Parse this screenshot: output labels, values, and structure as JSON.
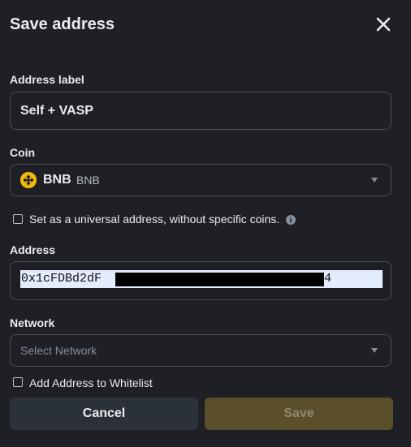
{
  "modal": {
    "title": "Save address",
    "close_icon": "close-icon"
  },
  "address_label": {
    "label": "Address label",
    "value": "Self + VASP"
  },
  "coin": {
    "label": "Coin",
    "symbol": "BNB",
    "name": "BNB",
    "icon": "bnb-coin-icon",
    "icon_color": "#f0b90b"
  },
  "universal": {
    "label": "Set as a universal address, without specific coins.",
    "checked": false,
    "info_icon": "info-icon"
  },
  "address": {
    "label": "Address",
    "value_visible": "0x1cFDBd2dF",
    "value_tail": "4"
  },
  "network": {
    "label": "Network",
    "placeholder": "Select Network"
  },
  "whitelist": {
    "label": "Add Address to Whitelist",
    "checked": false
  },
  "buttons": {
    "cancel": "Cancel",
    "save": "Save"
  },
  "colors": {
    "background": "#1e2026",
    "field_border": "#474d57",
    "accent": "#f0b90b",
    "save_disabled": "#5a4f2a"
  }
}
